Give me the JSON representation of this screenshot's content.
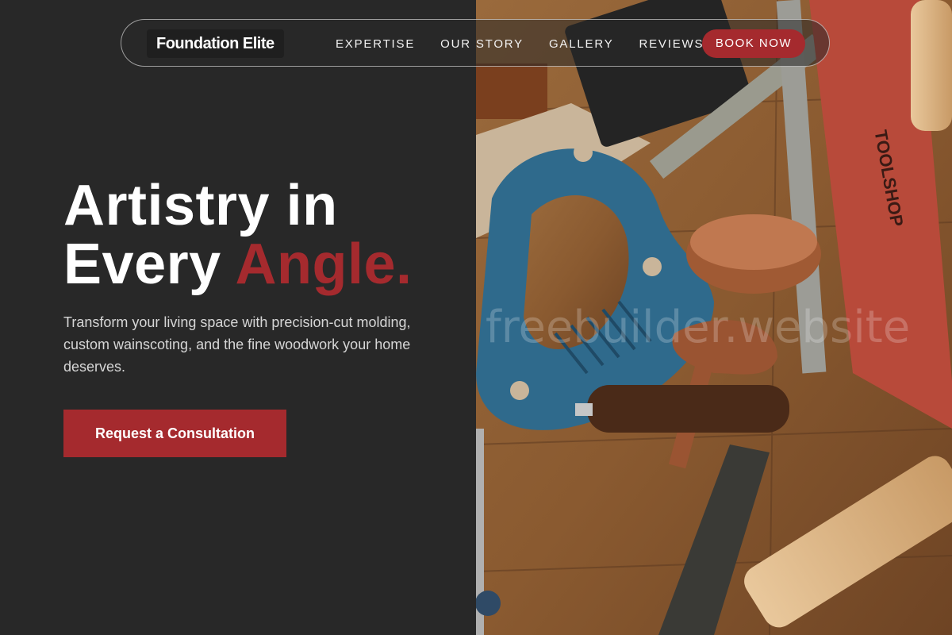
{
  "nav": {
    "brand": "Foundation Elite",
    "links": [
      "EXPERTISE",
      "OUR STORY",
      "GALLERY",
      "REVIEWS"
    ],
    "book_button": "BOOK NOW"
  },
  "hero": {
    "title_line1": "Artistry in",
    "title_line2_prefix": "Every ",
    "title_line2_accent": "Angle.",
    "subtitle": "Transform your living space with precision-cut molding, custom wainscoting, and the fine woodwork your home deserves.",
    "cta": "Request a Consultation"
  },
  "watermark": "freebuilder.website",
  "colors": {
    "background": "#282828",
    "accent": "#a52a2e",
    "text": "#ffffff",
    "muted_text": "#d6d6d6"
  },
  "image": {
    "subject": "woodworking-tools-on-wooden-bench"
  }
}
